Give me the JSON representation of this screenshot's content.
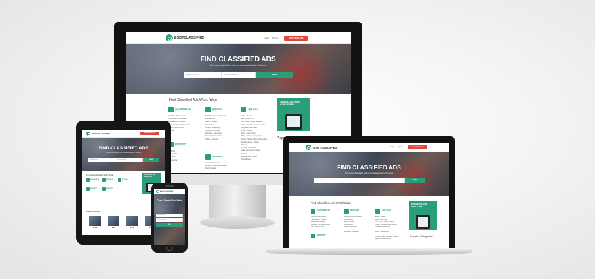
{
  "brand": {
    "name": "BOOTCLASSIFIED",
    "accent": "#2a9d7a",
    "post_color": "#e0453a"
  },
  "nav": {
    "login": "Login",
    "signup": "Signup",
    "post_ad": "POST FREE ADS"
  },
  "hero": {
    "title": "FIND CLASSIFIED ADS",
    "subtitle": "Find local classified ads on bootclassified in Minutes",
    "search_placeholder_1": "What?Anywhere",
    "search_placeholder_2": "Choose category",
    "search_button": "FIND"
  },
  "section_title": "Find Classified Ads World Wide",
  "categories": [
    {
      "name": "AUTOMOBILES",
      "count": "2,358",
      "items": [
        "Car Parts & Accessories",
        "Campervans & Caravans",
        "Motorbikes & Scooters",
        "Motorbike Parts & Accessories",
        "Vans, Trucks & Plant",
        "Wanted"
      ]
    },
    {
      "name": "SERVICES",
      "count": "1,020",
      "items": [
        "Building, Home & Removals",
        "Entertainment",
        "Health & Beauty",
        "Miscellaneous",
        "Property & Shipping",
        "Tax, Money & Visas",
        "Telecoms & Computing",
        "Travel Services & Tours",
        "Tuition & Lessons"
      ]
    },
    {
      "name": "FOR SALE",
      "count": "3,110",
      "items": [
        "Audio & Stereo",
        "Baby & Kids Stuff",
        "CDs, DVDs, Games & Books",
        "Clothes, Footwear & Accessories",
        "Computers & Software",
        "Home & Garden",
        "Music & Instruments",
        "Office Furniture & Equipment",
        "Phones, Mobile Phones & Telecoms",
        "Sports, Leisure & Travel",
        "Tickets",
        "TV, DVD & Cameras",
        "Video Games & Consoles",
        "Freebies",
        "Miscellaneous Goods",
        "Stuff Wanted"
      ]
    },
    {
      "name": "PROPERTY",
      "count": "890",
      "items": [
        "For Rent",
        "Land & Plots",
        "For Sale",
        "Commercial"
      ]
    },
    {
      "name": "LEARNING",
      "count": "640",
      "items": [
        "Automobile Classes",
        "Computer Multimedia Classes",
        "Sports Classes"
      ]
    }
  ],
  "app_promo": {
    "text": "DOWNLOAD OUR MOBILE APP"
  },
  "popular_title": "Popular Categories",
  "popular_title_cropped": "Popu",
  "featured_title": "Featured Listings",
  "listing_prices": [
    "$ 320",
    "$ 450",
    "$ 380",
    "$ 610"
  ],
  "phone_hero_title": "Find Classified Ads"
}
